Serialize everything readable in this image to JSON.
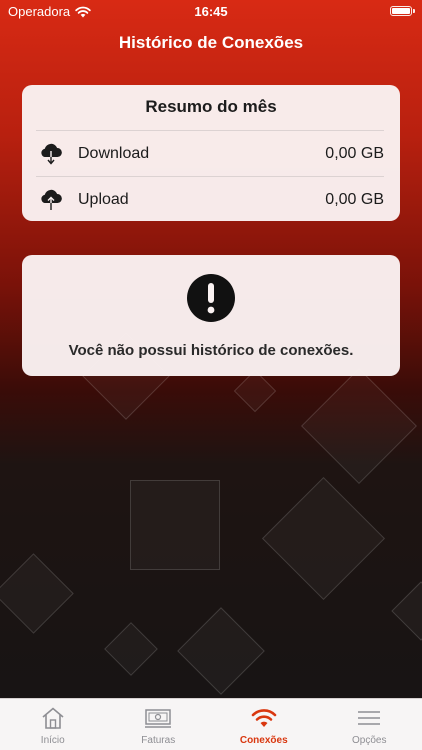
{
  "status_bar": {
    "carrier": "Operadora",
    "time": "16:45"
  },
  "nav": {
    "title": "Histórico de Conexões"
  },
  "summary": {
    "title": "Resumo do mês",
    "rows": [
      {
        "label": "Download",
        "value": "0,00 GB",
        "icon": "cloud-download-icon"
      },
      {
        "label": "Upload",
        "value": "0,00 GB",
        "icon": "cloud-upload-icon"
      }
    ]
  },
  "empty_state": {
    "icon": "exclamation-circle-icon",
    "message": "Você não possui histórico de conexões."
  },
  "tabs": [
    {
      "label": "Início",
      "icon": "home-icon"
    },
    {
      "label": "Faturas",
      "icon": "banknote-icon"
    },
    {
      "label": "Conexões",
      "icon": "wifi-icon",
      "active": true
    },
    {
      "label": "Opções",
      "icon": "menu-icon"
    }
  ],
  "colors": {
    "accent": "#d9370f",
    "header_red": "#d82a14",
    "card_bg": "#faf2f2"
  }
}
